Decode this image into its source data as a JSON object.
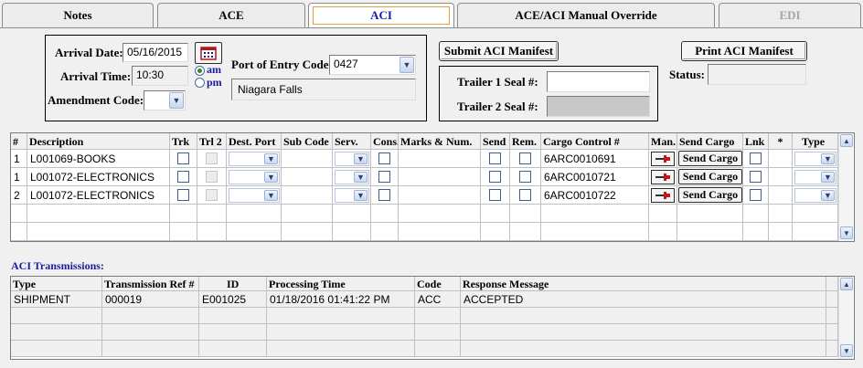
{
  "tabs": [
    {
      "label": "Notes",
      "state": "normal"
    },
    {
      "label": "ACE",
      "state": "normal"
    },
    {
      "label": "ACI",
      "state": "active"
    },
    {
      "label": "ACE/ACI Manual Override",
      "state": "normal"
    },
    {
      "label": "EDI",
      "state": "disabled"
    }
  ],
  "header": {
    "arrival_date_label": "Arrival Date:",
    "arrival_date_value": "05/16/2015",
    "arrival_time_label": "Arrival Time:",
    "arrival_time_value": "10:30",
    "am_label": "am",
    "pm_label": "pm",
    "am_selected": true,
    "amendment_code_label": "Amendment Code:",
    "amendment_code_value": "",
    "port_label": "Port of Entry Code:",
    "port_code_value": "0427",
    "port_name_value": "Niagara Falls",
    "submit_button": "Submit ACI Manifest",
    "print_button": "Print ACI Manifest",
    "status_label": "Status:",
    "status_value": "",
    "trailer1_label": "Trailer 1 Seal #:",
    "trailer1_value": "",
    "trailer2_label": "Trailer 2 Seal #:",
    "trailer2_value": ""
  },
  "cargo_grid": {
    "columns": [
      "#",
      "Description",
      "Trk",
      "Trl 2",
      "Dest. Port",
      "Sub Code",
      "Serv.",
      "Cons.",
      "Marks & Num.",
      "Send",
      "Rem.",
      "Cargo Control #",
      "Man.",
      "Send Cargo",
      "Lnk",
      "*",
      "Type"
    ],
    "rows": [
      {
        "num": "1",
        "description": "L001069-BOOKS",
        "cargo_control": "6ARC0010691",
        "send_cargo_label": "Send Cargo"
      },
      {
        "num": "1",
        "description": "L001072-ELECTRONICS",
        "cargo_control": "6ARC0010721",
        "send_cargo_label": "Send Cargo"
      },
      {
        "num": "2",
        "description": "L001072-ELECTRONICS",
        "cargo_control": "6ARC0010722",
        "send_cargo_label": "Send Cargo"
      }
    ]
  },
  "transmissions": {
    "title": "ACI Transmissions:",
    "columns": [
      "Type",
      "Transmission Ref #",
      "ID",
      "Processing Time",
      "Code",
      "Response Message"
    ],
    "rows": [
      {
        "type": "SHIPMENT",
        "ref": "000019",
        "id": "E001025",
        "time": "01/18/2016 01:41:22 PM",
        "code": "ACC",
        "message": "ACCEPTED"
      }
    ]
  },
  "icons": [
    "calendar-icon",
    "manifest-pin-icon",
    "dropdown-arrow-icon",
    "scroll-up-icon",
    "scroll-down-icon"
  ]
}
